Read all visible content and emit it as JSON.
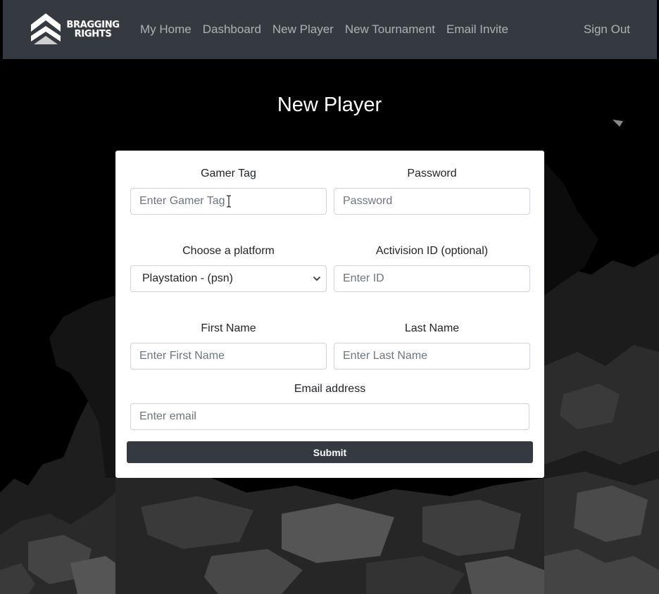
{
  "brand": {
    "logo_text_line1": "BRAGGING",
    "logo_text_line2": "RIGHTS"
  },
  "nav": {
    "links": [
      {
        "label": "My Home"
      },
      {
        "label": "Dashboard"
      },
      {
        "label": "New Player"
      },
      {
        "label": "New Tournament"
      },
      {
        "label": "Email Invite"
      }
    ],
    "sign_out": "Sign Out"
  },
  "page": {
    "title": "New Player"
  },
  "form": {
    "gamer_tag": {
      "label": "Gamer Tag",
      "placeholder": "Enter Gamer Tag",
      "value": ""
    },
    "password": {
      "label": "Password",
      "placeholder": "Password",
      "value": ""
    },
    "platform": {
      "label": "Choose a platform",
      "selected": "Playstation - (psn)"
    },
    "activision_id": {
      "label": "Activision ID (optional)",
      "placeholder": "Enter ID",
      "value": ""
    },
    "first_name": {
      "label": "First Name",
      "placeholder": "Enter First Name",
      "value": ""
    },
    "last_name": {
      "label": "Last Name",
      "placeholder": "Enter Last Name",
      "value": ""
    },
    "email": {
      "label": "Email address",
      "placeholder": "Enter email",
      "value": ""
    },
    "submit_label": "Submit"
  },
  "icons": {
    "logo": "chevron-logo-icon",
    "select_arrow": "chevron-down-icon",
    "cursor": "text-cursor-icon"
  },
  "colors": {
    "navbar": "#343a40",
    "page_bg": "#000000",
    "card_bg": "#ffffff",
    "submit_bg": "#343a40",
    "nav_text": "rgba(255,255,255,0.6)"
  }
}
